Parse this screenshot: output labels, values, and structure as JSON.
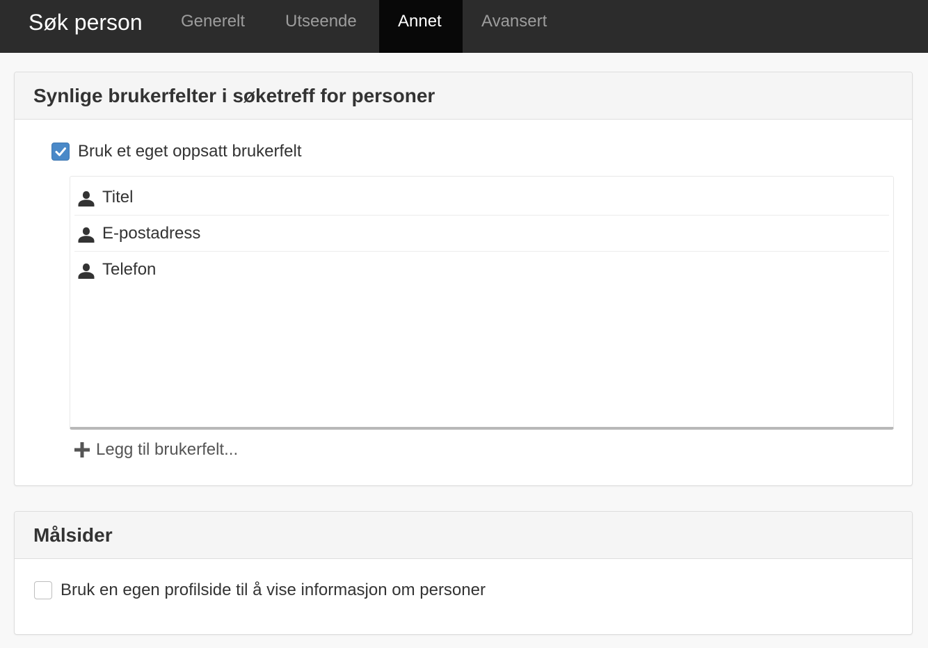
{
  "nav": {
    "brand": "Søk person",
    "tabs": [
      {
        "label": "Generelt",
        "active": false
      },
      {
        "label": "Utseende",
        "active": false
      },
      {
        "label": "Annet",
        "active": true
      },
      {
        "label": "Avansert",
        "active": false
      }
    ]
  },
  "panel_fields": {
    "title": "Synlige brukerfelter i søketreff for personer",
    "custom_fields_checkbox": {
      "label": "Bruk et eget oppsatt brukerfelt",
      "checked": true
    },
    "fields": [
      {
        "label": "Titel",
        "icon": "person-icon"
      },
      {
        "label": "E-postadress",
        "icon": "person-icon"
      },
      {
        "label": "Telefon",
        "icon": "person-icon"
      }
    ],
    "add_field_label": "Legg til brukerfelt..."
  },
  "panel_target": {
    "title": "Målsider",
    "profile_page_checkbox": {
      "label": "Bruk en egen profilside til å vise informasjon om personer",
      "checked": false
    }
  },
  "colors": {
    "navbar": "#2c2c2c",
    "active_tab": "#080808",
    "checkbox_checked": "#4a89c8"
  }
}
